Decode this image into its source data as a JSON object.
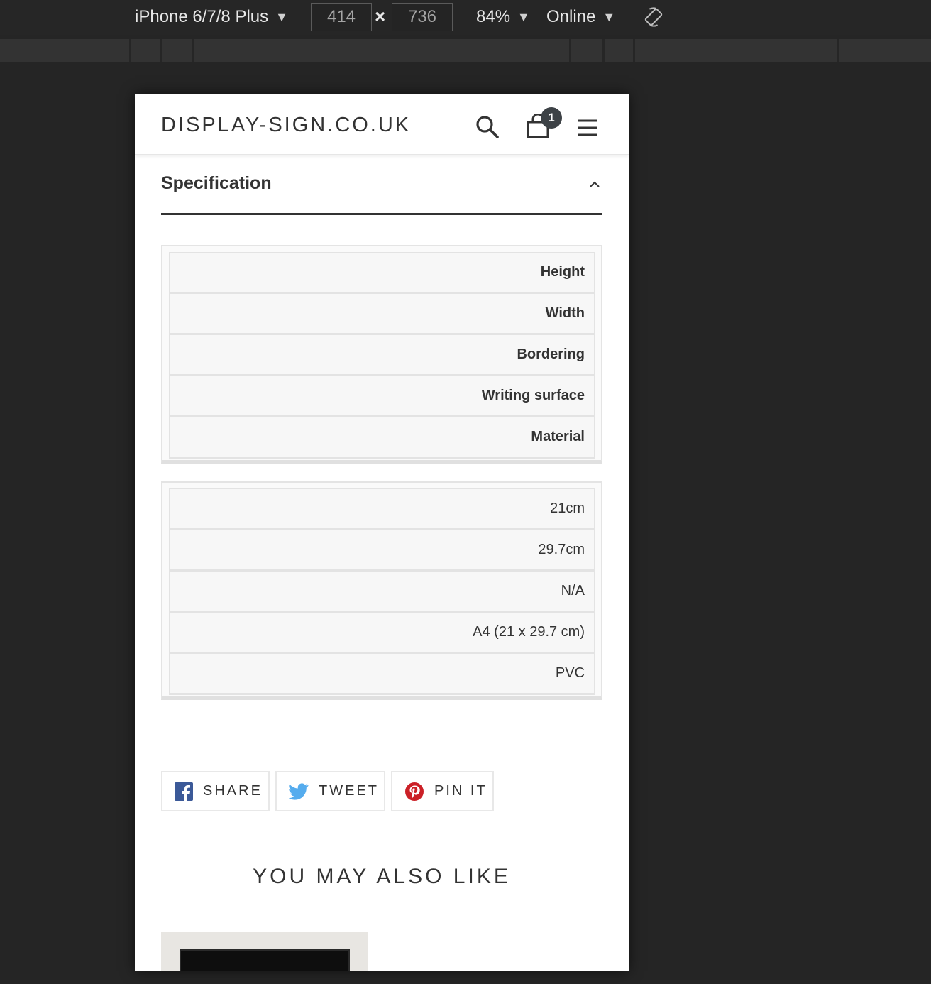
{
  "devtools": {
    "device": "iPhone 6/7/8 Plus",
    "width": "414",
    "height": "736",
    "times": "×",
    "zoom": "84%",
    "network": "Online",
    "caret": "▼"
  },
  "header": {
    "logo": "DISPLAY-SIGN.CO.UK",
    "cart_count": "1"
  },
  "specification": {
    "title": "Specification",
    "labels": [
      "Height",
      "Width",
      "Bordering",
      "Writing surface",
      "Material"
    ],
    "values": [
      "21cm",
      "29.7cm",
      "N/A",
      "A4 (21 x 29.7 cm)",
      "PVC"
    ]
  },
  "share": {
    "facebook": "SHARE",
    "twitter": "TWEET",
    "pinterest": "PIN IT"
  },
  "recommendations": {
    "title": "YOU MAY ALSO LIKE"
  },
  "colors": {
    "facebook": "#3b5998",
    "twitter": "#55acee",
    "pinterest": "#cb2027",
    "text": "#333333",
    "devtools_bg": "#262626"
  }
}
